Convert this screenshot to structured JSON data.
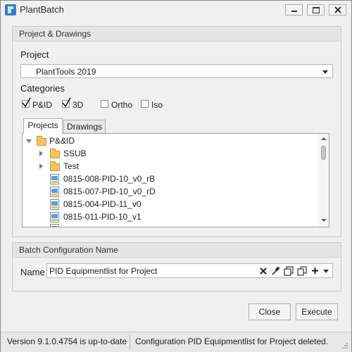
{
  "window": {
    "title": "PlantBatch",
    "icon": "plantbatch-app-icon",
    "controls": [
      "minimize-icon",
      "maximize-icon",
      "close-icon"
    ]
  },
  "project_group": {
    "header": "Project & Drawings",
    "project_label": "Project",
    "project_value": "PlantTools 2019",
    "categories_label": "Categories",
    "categories": [
      {
        "label": "P&ID",
        "checked": true
      },
      {
        "label": "3D",
        "checked": true
      },
      {
        "label": "Ortho",
        "checked": false
      },
      {
        "label": "Iso",
        "checked": false
      }
    ],
    "tabs": [
      {
        "label": "Projects",
        "active": true
      },
      {
        "label": "Drawings",
        "active": false
      }
    ],
    "tree": {
      "root": "P&&ID",
      "folders": [
        "SSUB",
        "Test"
      ],
      "files": [
        "0815-008-PID-10_v0_rB",
        "0815-007-PID-10_v0_rD",
        "0815-004-PID-11_v0",
        "0815-011-PID-10_v1"
      ]
    }
  },
  "batch_group": {
    "header": "Batch Configuration Name",
    "name_label": "Name",
    "name_value": "PID Equipmentlist for Project",
    "actions": [
      "clear-icon",
      "eyedropper-icon",
      "copy-icon",
      "duplicate-icon",
      "add-icon",
      "dropdown-chevron-icon"
    ]
  },
  "buttons": {
    "close": "Close",
    "execute": "Execute"
  },
  "status": {
    "version": "Version 9.1.0.4754 is up-to-date",
    "message": "Configuration PID Equipmentlist for Project deleted."
  },
  "colors": {
    "accent": "#3a7cc2",
    "folder": "#f4c463",
    "background": "#f0f0f0"
  }
}
